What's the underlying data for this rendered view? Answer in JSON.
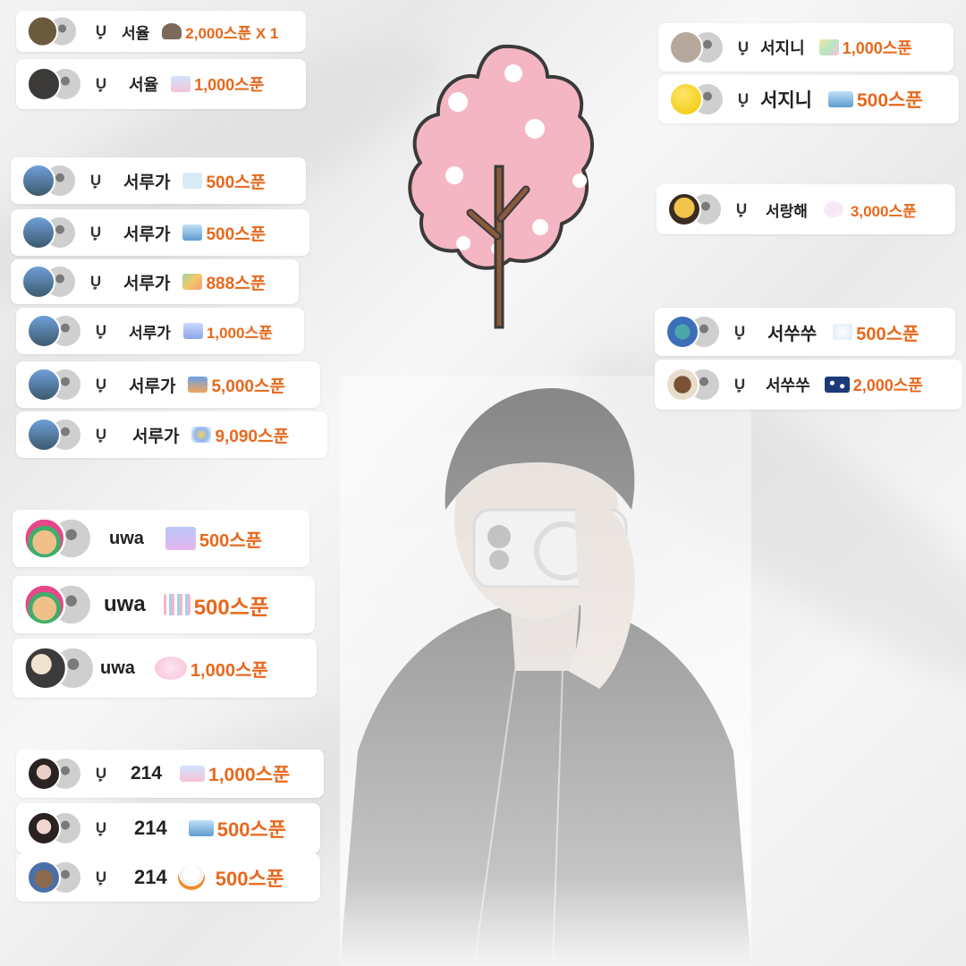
{
  "colors": {
    "amount": "#e8681c",
    "nickname": "#222222",
    "card": "#ffffff",
    "blossom": "#f4b6c2",
    "trunk": "#8a5a3b"
  },
  "badge_symbol": "Ụ",
  "illustration": {
    "name": "cherry-blossom-tree-doodle"
  },
  "cards": [
    {
      "nick": "서율",
      "amount": "2,000스푼 X 1",
      "badge": true
    },
    {
      "nick": "서율",
      "amount": "1,000스푼",
      "badge": true
    },
    {
      "nick": "서루가",
      "amount": "500스푼",
      "badge": true
    },
    {
      "nick": "서루가",
      "amount": "500스푼",
      "badge": true
    },
    {
      "nick": "서루가",
      "amount": "888스푼",
      "badge": true
    },
    {
      "nick": "서루가",
      "amount": "1,000스푼",
      "badge": true
    },
    {
      "nick": "서루가",
      "amount": "5,000스푼",
      "badge": true
    },
    {
      "nick": "서루가",
      "amount": "9,090스푼",
      "badge": true
    },
    {
      "nick": "uwa",
      "amount": "500스푼",
      "badge": false
    },
    {
      "nick": "uwa",
      "amount": "500스푼",
      "badge": false
    },
    {
      "nick": "uwa",
      "amount": "1,000스푼",
      "badge": false
    },
    {
      "nick": "214",
      "amount": "1,000스푼",
      "badge": true
    },
    {
      "nick": "214",
      "amount": "500스푼",
      "badge": true
    },
    {
      "nick": "214",
      "amount": "500스푼",
      "badge": true
    },
    {
      "nick": "서지니",
      "amount": "1,000스푼",
      "badge": true
    },
    {
      "nick": "서지니",
      "amount": "500스푼",
      "badge": true
    },
    {
      "nick": "서랑해",
      "amount": "3,000스푼",
      "badge": true
    },
    {
      "nick": "서쑤쑤",
      "amount": "500스푼",
      "badge": true
    },
    {
      "nick": "서쑤쑤",
      "amount": "2,000스푼",
      "badge": true
    }
  ]
}
